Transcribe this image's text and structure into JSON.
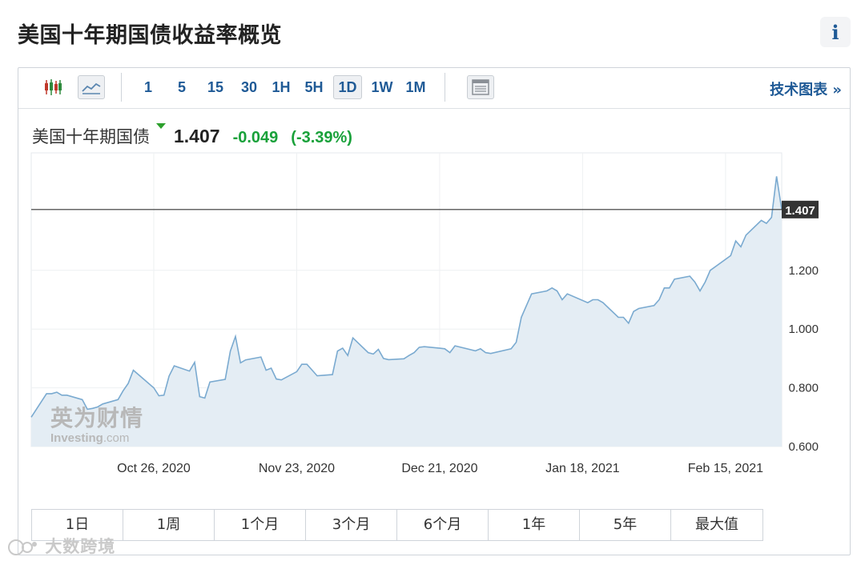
{
  "header": {
    "title": "美国十年期国债收益率概览",
    "info_label": "i"
  },
  "toolbar": {
    "intervals": [
      "1",
      "5",
      "15",
      "30",
      "1H",
      "5H",
      "1D",
      "1W",
      "1M"
    ],
    "active_interval": "1D",
    "tech_chart_link": "技术图表 »",
    "icons": [
      "candlestick-icon",
      "line-chart-icon",
      "table-icon"
    ]
  },
  "quote": {
    "name": "美国十年期国债",
    "price": "1.407",
    "change": "-0.049",
    "change_pct": "(-3.39%)"
  },
  "range_tabs": [
    "1日",
    "1周",
    "1个月",
    "3个月",
    "6个月",
    "1年",
    "5年",
    "最大值"
  ],
  "watermark": {
    "cn": "英为财情",
    "en_main": "Investing",
    "en_suffix": ".com",
    "corner": "大数跨境"
  },
  "colors": {
    "line": "#7aaad0",
    "fill": "#e4edf4",
    "positive": "#19a13a",
    "link": "#1f5a96",
    "marker": "#2ca02c"
  },
  "chart_data": {
    "type": "area",
    "x": [
      "2020-10-02",
      "2020-10-05",
      "2020-10-06",
      "2020-10-07",
      "2020-10-08",
      "2020-10-09",
      "2020-10-12",
      "2020-10-13",
      "2020-10-14",
      "2020-10-15",
      "2020-10-16",
      "2020-10-19",
      "2020-10-20",
      "2020-10-21",
      "2020-10-22",
      "2020-10-23",
      "2020-10-26",
      "2020-10-27",
      "2020-10-28",
      "2020-10-29",
      "2020-10-30",
      "2020-11-02",
      "2020-11-03",
      "2020-11-04",
      "2020-11-05",
      "2020-11-06",
      "2020-11-09",
      "2020-11-10",
      "2020-11-11",
      "2020-11-12",
      "2020-11-13",
      "2020-11-16",
      "2020-11-17",
      "2020-11-18",
      "2020-11-19",
      "2020-11-20",
      "2020-11-23",
      "2020-11-24",
      "2020-11-25",
      "2020-11-27",
      "2020-11-30",
      "2020-12-01",
      "2020-12-02",
      "2020-12-03",
      "2020-12-04",
      "2020-12-07",
      "2020-12-08",
      "2020-12-09",
      "2020-12-10",
      "2020-12-11",
      "2020-12-14",
      "2020-12-15",
      "2020-12-16",
      "2020-12-17",
      "2020-12-18",
      "2020-12-21",
      "2020-12-22",
      "2020-12-23",
      "2020-12-24",
      "2020-12-28",
      "2020-12-29",
      "2020-12-30",
      "2020-12-31",
      "2021-01-04",
      "2021-01-05",
      "2021-01-06",
      "2021-01-07",
      "2021-01-08",
      "2021-01-11",
      "2021-01-12",
      "2021-01-13",
      "2021-01-14",
      "2021-01-15",
      "2021-01-19",
      "2021-01-20",
      "2021-01-21",
      "2021-01-22",
      "2021-01-25",
      "2021-01-26",
      "2021-01-27",
      "2021-01-28",
      "2021-01-29",
      "2021-02-01",
      "2021-02-02",
      "2021-02-03",
      "2021-02-04",
      "2021-02-05",
      "2021-02-08",
      "2021-02-09",
      "2021-02-10",
      "2021-02-11",
      "2021-02-12",
      "2021-02-16",
      "2021-02-17",
      "2021-02-18",
      "2021-02-19",
      "2021-02-22",
      "2021-02-23",
      "2021-02-24",
      "2021-02-25",
      "2021-02-26"
    ],
    "y": [
      0.7,
      0.78,
      0.78,
      0.785,
      0.775,
      0.775,
      0.76,
      0.727,
      0.73,
      0.735,
      0.745,
      0.76,
      0.79,
      0.815,
      0.86,
      0.845,
      0.8,
      0.773,
      0.775,
      0.84,
      0.875,
      0.857,
      0.887,
      0.77,
      0.765,
      0.82,
      0.829,
      0.925,
      0.975,
      0.885,
      0.895,
      0.905,
      0.86,
      0.867,
      0.83,
      0.827,
      0.855,
      0.88,
      0.88,
      0.841,
      0.845,
      0.925,
      0.935,
      0.91,
      0.97,
      0.92,
      0.915,
      0.931,
      0.9,
      0.896,
      0.899,
      0.91,
      0.92,
      0.938,
      0.94,
      0.935,
      0.933,
      0.92,
      0.943,
      0.926,
      0.933,
      0.92,
      0.917,
      0.933,
      0.955,
      1.04,
      1.08,
      1.12,
      1.13,
      1.14,
      1.13,
      1.1,
      1.12,
      1.09,
      1.1,
      1.1,
      1.09,
      1.04,
      1.04,
      1.02,
      1.06,
      1.07,
      1.08,
      1.1,
      1.14,
      1.14,
      1.17,
      1.18,
      1.16,
      1.13,
      1.16,
      1.2,
      1.25,
      1.3,
      1.28,
      1.32,
      1.37,
      1.36,
      1.38,
      1.52,
      1.407
    ],
    "x_ticks": [
      "Oct 26, 2020",
      "Nov 23, 2020",
      "Dec 21, 2020",
      "Jan 18, 2021",
      "Feb 15, 2021"
    ],
    "y_ticks": [
      "0.600",
      "0.800",
      "1.000",
      "1.200"
    ],
    "ylim": [
      0.6,
      1.6
    ],
    "reference_line": 1.407,
    "reference_label": "1.407",
    "grid": true,
    "axis_side": "right"
  }
}
